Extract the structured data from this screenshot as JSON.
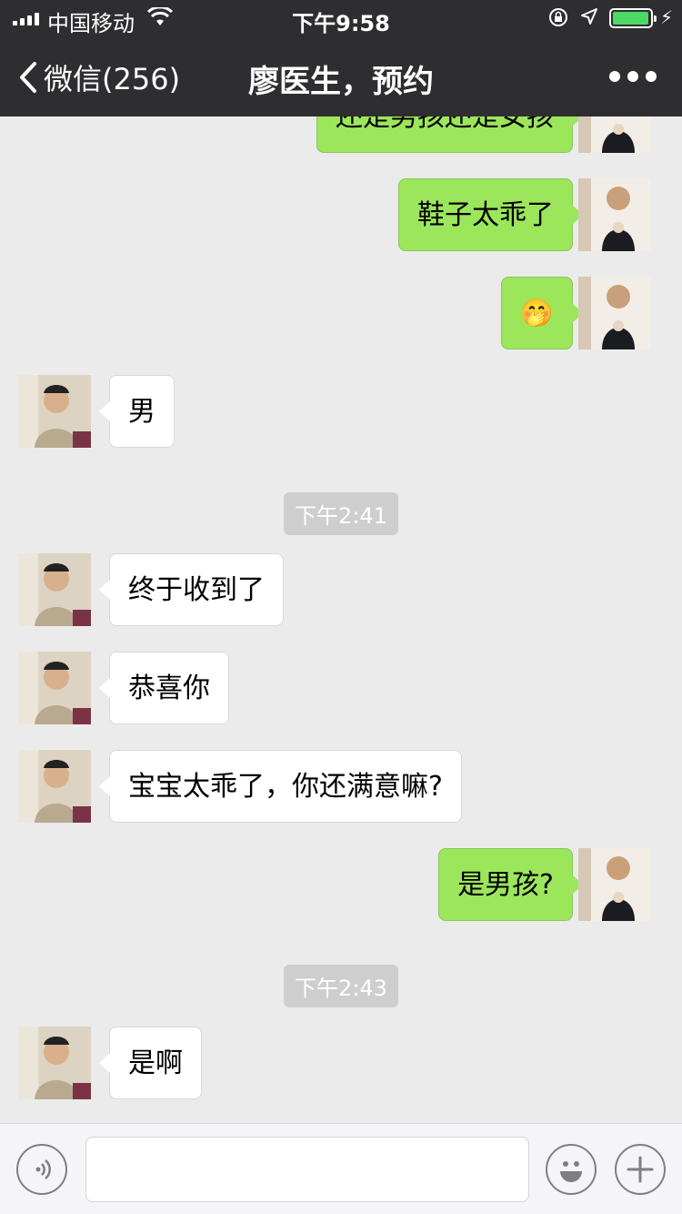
{
  "status_bar": {
    "carrier": "中国移动",
    "time": "下午9:58"
  },
  "nav": {
    "back_label": "微信(256)",
    "title": "廖医生，预约"
  },
  "messages": [
    {
      "from": "me",
      "text": "还是男孩还是女孩"
    },
    {
      "from": "me",
      "text": "鞋子太乖了"
    },
    {
      "from": "me",
      "text": "🤭"
    },
    {
      "from": "them",
      "text": "男"
    },
    {
      "type": "timestamp",
      "text": "下午2:41"
    },
    {
      "from": "them",
      "text": "终于收到了"
    },
    {
      "from": "them",
      "text": "恭喜你"
    },
    {
      "from": "them",
      "text": "宝宝太乖了，你还满意嘛?"
    },
    {
      "from": "me",
      "text": "是男孩?"
    },
    {
      "type": "timestamp",
      "text": "下午2:43"
    },
    {
      "from": "them",
      "text": "是啊"
    }
  ],
  "colors": {
    "header_bg": "#2e2e30",
    "chat_bg": "#ebebeb",
    "outgoing_bubble": "#9ce65c",
    "incoming_bubble": "#ffffff",
    "battery": "#4cd964"
  }
}
